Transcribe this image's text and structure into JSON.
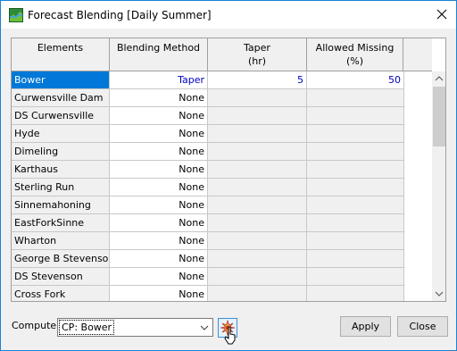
{
  "window": {
    "title": "Forecast Blending [Daily Summer]",
    "accent": "#1883d7",
    "selection_color": "#0078d7"
  },
  "icons": {
    "app": "forecast-app-icon",
    "close": "close-icon",
    "compute": "compute-icon"
  },
  "table": {
    "headers": {
      "elements": "Elements",
      "method": "Blending Method",
      "taper_line1": "Taper",
      "taper_line2": "(hr)",
      "missing_line1": "Allowed Missing",
      "missing_line2": "(%)"
    },
    "rows": [
      {
        "name": "Bower",
        "method": "Taper",
        "taper": "5",
        "missing": "50"
      },
      {
        "name": "Curwensville Dam",
        "method": "None",
        "taper": "",
        "missing": ""
      },
      {
        "name": "DS Curwensville",
        "method": "None",
        "taper": "",
        "missing": ""
      },
      {
        "name": "Hyde",
        "method": "None",
        "taper": "",
        "missing": ""
      },
      {
        "name": "Dimeling",
        "method": "None",
        "taper": "",
        "missing": ""
      },
      {
        "name": "Karthaus",
        "method": "None",
        "taper": "",
        "missing": ""
      },
      {
        "name": "Sterling Run",
        "method": "None",
        "taper": "",
        "missing": ""
      },
      {
        "name": "Sinnemahoning",
        "method": "None",
        "taper": "",
        "missing": ""
      },
      {
        "name": "EastForkSinne",
        "method": "None",
        "taper": "",
        "missing": ""
      },
      {
        "name": "Wharton",
        "method": "None",
        "taper": "",
        "missing": ""
      },
      {
        "name": "George B Stevenso...",
        "method": "None",
        "taper": "",
        "missing": ""
      },
      {
        "name": "DS Stevenson",
        "method": "None",
        "taper": "",
        "missing": ""
      },
      {
        "name": "Cross Fork",
        "method": "None",
        "taper": "",
        "missing": ""
      }
    ]
  },
  "footer": {
    "compute_label": "Compute:",
    "compute_value": "CP: Bower",
    "apply_label": "Apply",
    "close_label": "Close"
  }
}
